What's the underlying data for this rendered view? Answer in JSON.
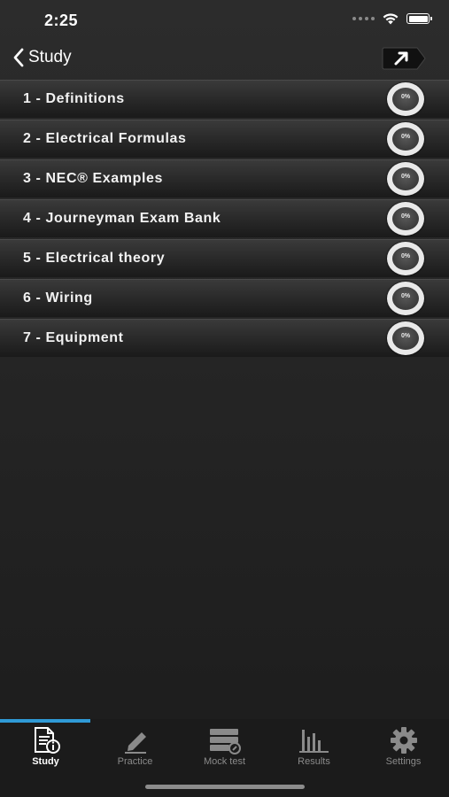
{
  "status_bar": {
    "time": "2:25"
  },
  "nav": {
    "back_label": "Study"
  },
  "topics": [
    {
      "label": "1 - Definitions",
      "progress": "0%"
    },
    {
      "label": "2 - Electrical Formulas",
      "progress": "0%"
    },
    {
      "label": "3 - NEC® Examples",
      "progress": "0%"
    },
    {
      "label": "4 - Journeyman Exam Bank",
      "progress": "0%"
    },
    {
      "label": "5 - Electrical theory",
      "progress": "0%"
    },
    {
      "label": "6 - Wiring",
      "progress": "0%"
    },
    {
      "label": "7 - Equipment",
      "progress": "0%"
    }
  ],
  "tabs": [
    {
      "label": "Study",
      "icon": "study-document-icon",
      "active": true
    },
    {
      "label": "Practice",
      "icon": "pencil-icon",
      "active": false
    },
    {
      "label": "Mock test",
      "icon": "mock-test-icon",
      "active": false
    },
    {
      "label": "Results",
      "icon": "bar-chart-icon",
      "active": false
    },
    {
      "label": "Settings",
      "icon": "gear-icon",
      "active": false
    }
  ],
  "colors": {
    "accent": "#2f9ad6",
    "background": "#252525",
    "text": "#ffffff",
    "inactive_tab": "#8a8a8a"
  }
}
